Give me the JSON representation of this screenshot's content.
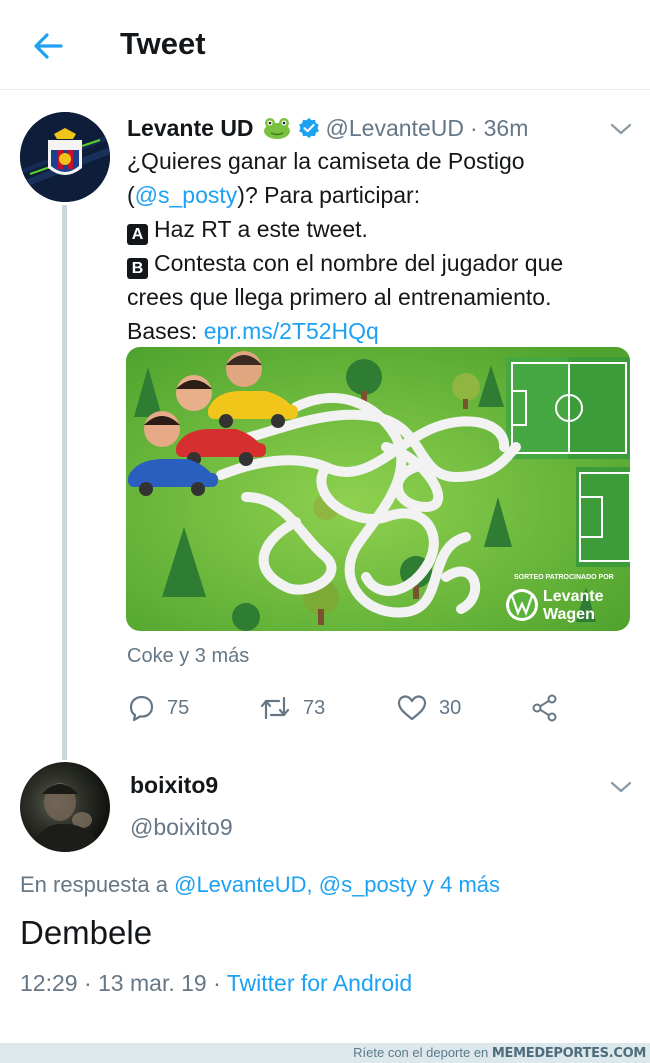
{
  "header": {
    "title": "Tweet"
  },
  "tweet": {
    "author_name": "Levante UD",
    "handle": "@LevanteUD",
    "separator": "·",
    "time": "36m",
    "text_line1": "¿Quieres ganar la camiseta de Postigo",
    "text_paren_open": "(",
    "mention": "@s_posty",
    "text_line2_rest": ")? Para participar:",
    "option_a_letter": "A",
    "option_a_text": "Haz RT a este tweet.",
    "option_b_letter": "B",
    "option_b_text": "Contesta con el nombre del jugador que",
    "text_line5": "crees que llega primero al entrenamiento.",
    "bases_label": "Bases: ",
    "bases_link": "epr.ms/2T52HQq",
    "media": {
      "sponsor_caption": "SORTEO PATROCINADO POR",
      "sponsor_line1": "Levante",
      "sponsor_line2": "Wagen"
    },
    "liked_by": "Coke y 3 más",
    "replies": "75",
    "retweets": "73",
    "likes": "30"
  },
  "reply": {
    "author_name": "boixito9",
    "handle": "@boixito9",
    "in_reply_prefix": "En respuesta a ",
    "in_reply_mentions": "@LevanteUD, @s_posty y 4 más",
    "text": "Dembele",
    "time": "12:29",
    "separator1": "·",
    "date": "13 mar. 19",
    "separator2": "·",
    "client": "Twitter for Android"
  },
  "footer": {
    "tagline": "Ríete con el deporte en ",
    "brand": "MEMEDEPORTES.COM"
  },
  "colors": {
    "accent": "#1da1f2",
    "secondary_text": "#657786",
    "thread_line": "#ccd6dd",
    "maze_green": "#67b83a"
  },
  "icons": [
    "back-arrow-icon",
    "frog-emoji-icon",
    "verified-badge-icon",
    "chevron-down-icon",
    "reply-icon",
    "retweet-icon",
    "like-icon",
    "share-icon"
  ]
}
